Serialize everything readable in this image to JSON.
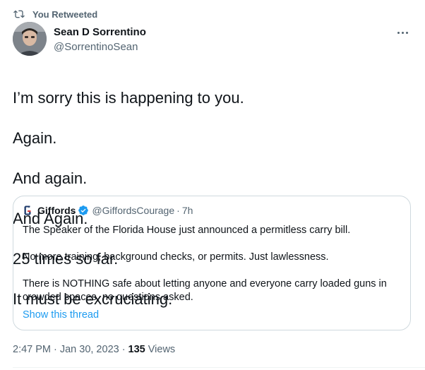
{
  "retweet": {
    "label": "You Retweeted",
    "icon": "retweet-icon"
  },
  "author": {
    "name": "Sean D Sorrentino",
    "handle": "@SorrentinoSean",
    "avatar_icon": "avatar"
  },
  "more_icon": "more-icon",
  "tweet": {
    "lines": [
      "I’m sorry this is happening to you.",
      "Again.",
      "And again.",
      "And Again.",
      "25 times so far.",
      "It must be excruciating."
    ]
  },
  "quote": {
    "name": "Giffords",
    "handle": "@GiffordsCourage",
    "separator": "·",
    "time": "7h",
    "verified_icon": "verified-badge-icon",
    "paragraphs": [
      "The Speaker of the Florida House just announced a permitless carry bill.",
      "No more training, background checks, or permits. Just lawlessness.",
      "There is NOTHING safe about letting anyone and everyone carry loaded guns in crowded spaces, no questions asked."
    ],
    "show_thread": "Show this thread"
  },
  "meta": {
    "time": "2:47 PM",
    "date": "Jan 30, 2023",
    "separator": "·",
    "views_count": "135",
    "views_label": "Views"
  },
  "colors": {
    "text": "#0f1419",
    "secondary": "#536471",
    "link": "#1d9bf0",
    "border": "#cfd9de"
  }
}
